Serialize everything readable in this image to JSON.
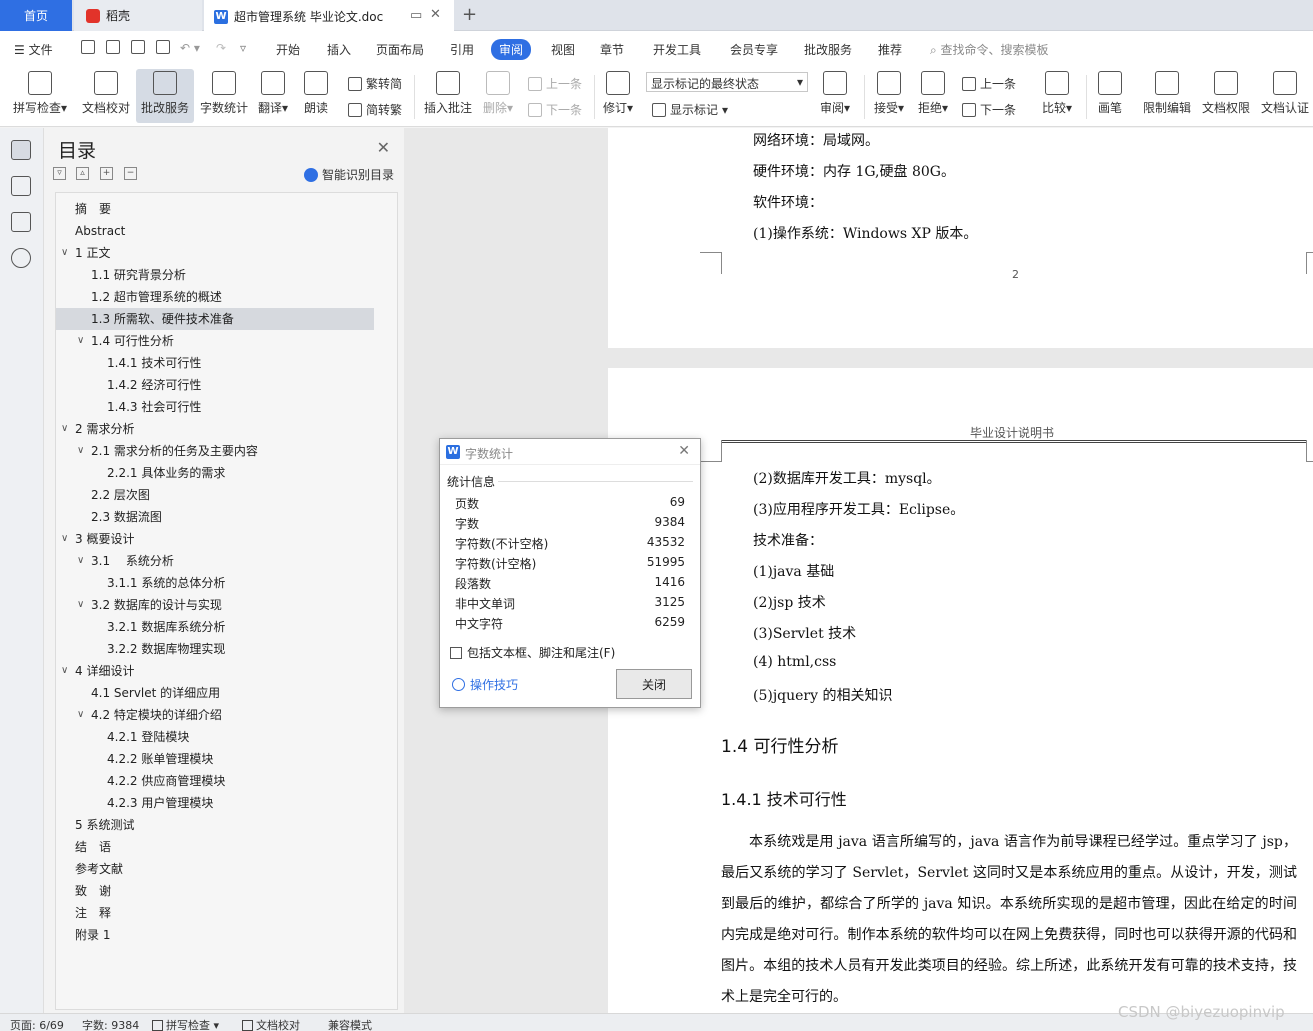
{
  "tabs": {
    "home": "首页",
    "daoke": "稻壳",
    "doc": "超市管理系统 毕业论文.doc"
  },
  "menubar": {
    "file": "文件",
    "items": [
      "开始",
      "插入",
      "页面布局",
      "引用",
      "审阅",
      "视图",
      "章节",
      "开发工具",
      "会员专享",
      "批改服务",
      "推荐"
    ],
    "active": "审阅",
    "search_placeholder": "查找命令、搜索模板"
  },
  "ribbon": {
    "spellcheck": "拼写检查",
    "doc_check": "文档校对",
    "proofread_service": "批改服务",
    "word_count": "字数统计",
    "translate": "翻译",
    "read_aloud": "朗读",
    "trad": "繁转简",
    "simp": "简转繁",
    "insert_comment": "插入批注",
    "delete": "删除",
    "prev": "上一条",
    "next": "下一条",
    "track": "修订",
    "markup_state": "显示标记的最终状态",
    "show_markup": "显示标记",
    "review": "审阅",
    "accept": "接受",
    "reject": "拒绝",
    "prev2": "上一条",
    "next2": "下一条",
    "compare": "比较",
    "pen": "画笔",
    "restrict": "限制编辑",
    "permission": "文档权限",
    "certify": "文档认证"
  },
  "toc": {
    "title": "目录",
    "smart": "智能识别目录",
    "items": [
      {
        "text": "摘　要",
        "level": 0,
        "chev": false
      },
      {
        "text": "Abstract",
        "level": 0,
        "chev": false
      },
      {
        "text": "1 正文",
        "level": 0,
        "chev": true
      },
      {
        "text": "1.1 研究背景分析",
        "level": 1,
        "chev": false
      },
      {
        "text": "1.2  超市管理系统的概述",
        "level": 1,
        "chev": false
      },
      {
        "text": "1.3 所需软、硬件技术准备",
        "level": 1,
        "chev": false,
        "sel": true
      },
      {
        "text": "1.4 可行性分析",
        "level": 1,
        "chev": true
      },
      {
        "text": "1.4.1  技术可行性",
        "level": 2,
        "chev": false
      },
      {
        "text": "1.4.2  经济可行性",
        "level": 2,
        "chev": false
      },
      {
        "text": "1.4.3  社会可行性",
        "level": 2,
        "chev": false
      },
      {
        "text": "2  需求分析",
        "level": 0,
        "chev": true
      },
      {
        "text": "2.1  需求分析的任务及主要内容",
        "level": 1,
        "chev": true
      },
      {
        "text": "2.2.1  具体业务的需求",
        "level": 2,
        "chev": false
      },
      {
        "text": "2.2  层次图",
        "level": 1,
        "chev": false
      },
      {
        "text": "2.3 数据流图",
        "level": 1,
        "chev": false
      },
      {
        "text": "3  概要设计",
        "level": 0,
        "chev": true
      },
      {
        "text": "3.1　 系统分析",
        "level": 1,
        "chev": true
      },
      {
        "text": "3.1.1  系统的总体分析",
        "level": 2,
        "chev": false
      },
      {
        "text": "3.2  数据库的设计与实现",
        "level": 1,
        "chev": true
      },
      {
        "text": "3.2.1  数据库系统分析",
        "level": 2,
        "chev": false
      },
      {
        "text": "3.2.2  数据库物理实现",
        "level": 2,
        "chev": false
      },
      {
        "text": "4  详细设计",
        "level": 0,
        "chev": true
      },
      {
        "text": "4.1 Servlet 的详细应用",
        "level": 1,
        "chev": false
      },
      {
        "text": "4.2  特定模块的详细介绍",
        "level": 1,
        "chev": true
      },
      {
        "text": "4.2.1  登陆模块",
        "level": 2,
        "chev": false
      },
      {
        "text": "4.2.2  账单管理模块",
        "level": 2,
        "chev": false
      },
      {
        "text": "4.2.2  供应商管理模块",
        "level": 2,
        "chev": false
      },
      {
        "text": "4.2.3  用户管理模块",
        "level": 2,
        "chev": false
      },
      {
        "text": "5  系统测试",
        "level": 0,
        "chev": false
      },
      {
        "text": "结　语",
        "level": 0,
        "chev": false
      },
      {
        "text": "参考文献",
        "level": 0,
        "chev": false
      },
      {
        "text": "致　谢",
        "level": 0,
        "chev": false
      },
      {
        "text": "注　释",
        "level": 0,
        "chev": false
      },
      {
        "text": "附录 1",
        "level": 0,
        "chev": false
      }
    ]
  },
  "document": {
    "page1_lines": [
      "网络环境：局域网。",
      "硬件环境：内存 1G,硬盘 80G。",
      "软件环境：",
      "(1)操作系统：Windows XP 版本。"
    ],
    "page_number": "2",
    "header": "毕业设计说明书",
    "page2_lines": [
      "(2)数据库开发工具：mysql。",
      "(3)应用程序开发工具：Eclipse。",
      "技术准备：",
      "(1)java 基础",
      "(2)jsp 技术",
      "(3)Servlet 技术",
      "(4) html,css",
      "(5)jquery 的相关知识"
    ],
    "h2": "1.4 可行性分析",
    "h3": "1.4.1  技术可行性",
    "paragraph": "本系统戏是用 java 语言所编写的，java 语言作为前导课程已经学过。重点学习了 jsp，最后又系统的学习了 Servlet，Servlet 这同时又是本系统应用的重点。从设计，开发，测试到最后的维护，都综合了所学的 java 知识。本系统所实现的是超市管理，因此在给定的时间内完成是绝对可行。制作本系统的软件均可以在网上免费获得，同时也可以获得开源的代码和图片。本组的技术人员有开发此类项目的经验。综上所述，此系统开发有可靠的技术支持，技术上是完全可行的。"
  },
  "dialog": {
    "title": "字数统计",
    "group": "统计信息",
    "stats": [
      {
        "label": "页数",
        "value": "69"
      },
      {
        "label": "字数",
        "value": "9384"
      },
      {
        "label": "字符数(不计空格)",
        "value": "43532"
      },
      {
        "label": "字符数(计空格)",
        "value": "51995"
      },
      {
        "label": "段落数",
        "value": "1416"
      },
      {
        "label": "非中文单词",
        "value": "3125"
      },
      {
        "label": "中文字符",
        "value": "6259"
      }
    ],
    "checkbox": "包括文本框、脚注和尾注(F)",
    "tips": "操作技巧",
    "close": "关闭"
  },
  "status": {
    "page": "页面: 6/69",
    "words": "字数: 9384",
    "spell": "拼写检查",
    "doccheck": "文档校对",
    "compat": "兼容模式"
  },
  "watermark": "CSDN @biyezuopinvip"
}
